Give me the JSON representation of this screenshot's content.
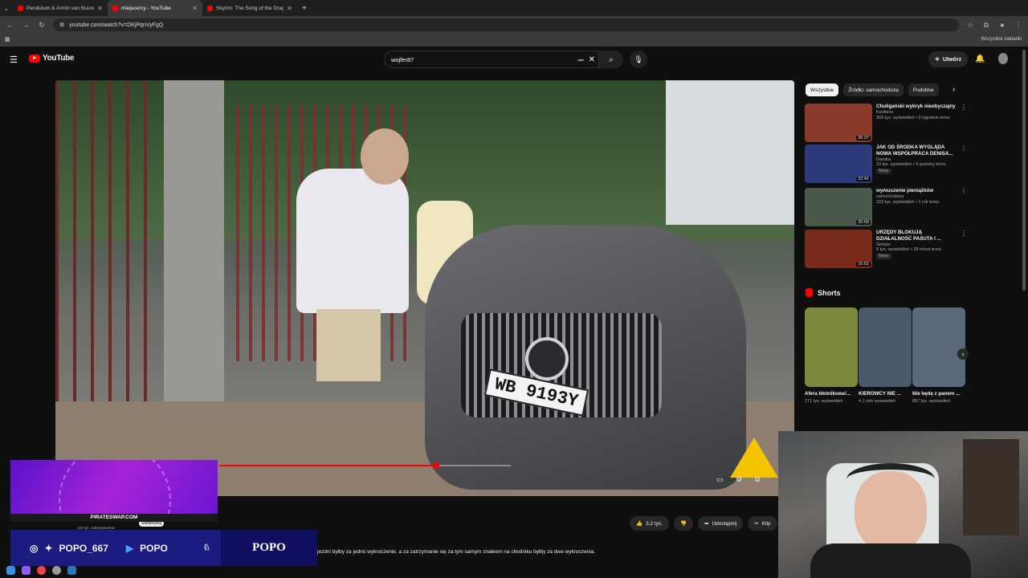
{
  "browser": {
    "tabs": [
      {
        "title": "Pendulum & Armin van Buuren",
        "active": false
      },
      {
        "title": "miejscercy - YouTube",
        "active": true
      },
      {
        "title": "Skyrim: The Song of the Dragon",
        "active": false
      }
    ],
    "new_tab": "+",
    "url": "youtube.com/watch?v=DKjPqnVyFgQ",
    "bookmarks_label": "Wszystkie zakładki"
  },
  "youtube": {
    "logo_text": "YouTube",
    "search_value": "wojfer87",
    "create_label": "Utwórz",
    "chips": [
      "Wszystkie",
      "Źródło: samochodoza",
      "Podobne"
    ],
    "recommendations": [
      {
        "title": "Chuligański wybryk nieobyczajny",
        "channel": "Konfisza",
        "meta": "303 tys. wyświetleń • 3 tygodnie temu",
        "duration": "35:37",
        "badge": "",
        "thumb_color": "#8a3a2a"
      },
      {
        "title": "JAK OD ŚRODKA WYGLĄDA NOWA WSPÓŁPRACA DENISA...",
        "channel": "Dandra",
        "meta": "10 tys. wyświetleń • 3 godziny temu",
        "duration": "22:41",
        "badge": "Nowy",
        "thumb_color": "#2a3a7a"
      },
      {
        "title": "wymuszenie pieniążków",
        "channel": "samochodoza",
        "meta": "222 tys. wyświetleń • 1 rok temu",
        "duration": "30:59",
        "badge": "",
        "thumb_color": "#4a5a4a"
      },
      {
        "title": "URZĘDY BLOKUJĄ DZIAŁALNOŚĆ PASUTA I ...",
        "channel": "Gimper",
        "meta": "9 tys. wyświetleń • 28 minut temu",
        "duration": "15:01",
        "badge": "Nowy",
        "thumb_color": "#7a2a1a"
      }
    ],
    "shorts_label": "Shorts",
    "shorts": [
      {
        "title": "Afera błotnikowa!...",
        "views": "271 tys. wyświetleń",
        "color": "#7a8a3a"
      },
      {
        "title": "KIEROWCY NIE ...",
        "views": "4,1 mln wyświetleń",
        "color": "#4a5a6a"
      },
      {
        "title": "Nie będę z panem ...",
        "views": "857 tys. wyświetleń",
        "color": "#5a6a7a"
      }
    ],
    "actions": {
      "like": "3,2 tys.",
      "share": "Udostępnij",
      "clip": "Klip"
    },
    "subtitle": "jezdni byłby za jedno wykroczenie, a za zatrzymanie się za tym samym znakiem na chodniku byłby za dwa wykroczenia.",
    "channel_subs": "120 tys. subskrybentów",
    "subscribe": "Subskrybuj",
    "plate": "WB 9193Y",
    "playback_progress": 0.744
  },
  "overlay": {
    "banner_site": "PIRATESWAP.COM",
    "social_instagram": "POPO_667",
    "social_youtube": "POPO",
    "brand": "POPO"
  }
}
